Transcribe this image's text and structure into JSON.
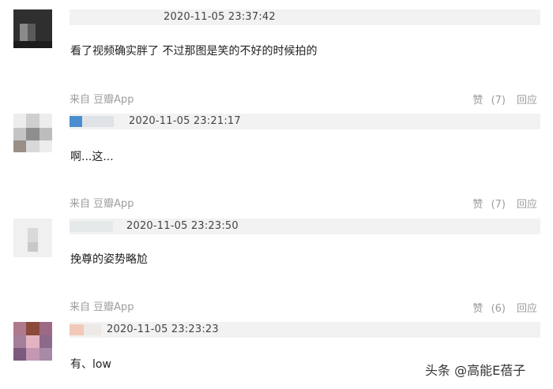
{
  "comments": [
    {
      "timestamp": "2020-11-05 23:37:42",
      "text": "看了视频确实胖了 不过那图是笑的不好的时候拍的",
      "source": "来自 豆瓣App",
      "like_label": "赞",
      "like_count": "(7)",
      "reply_label": "回应"
    },
    {
      "timestamp": "2020-11-05 23:21:17",
      "text": "啊...这...",
      "source": "来自 豆瓣App",
      "like_label": "赞",
      "like_count": "(7)",
      "reply_label": "回应"
    },
    {
      "timestamp": "2020-11-05 23:23:50",
      "text": "挽尊的姿势略尬",
      "source": "来自 豆瓣App",
      "like_label": "赞",
      "like_count": "(6)",
      "reply_label": "回应"
    },
    {
      "timestamp": "2020-11-05 23:23:23",
      "text": "有、low"
    }
  ],
  "watermark": "头条 @高能E蓓子"
}
